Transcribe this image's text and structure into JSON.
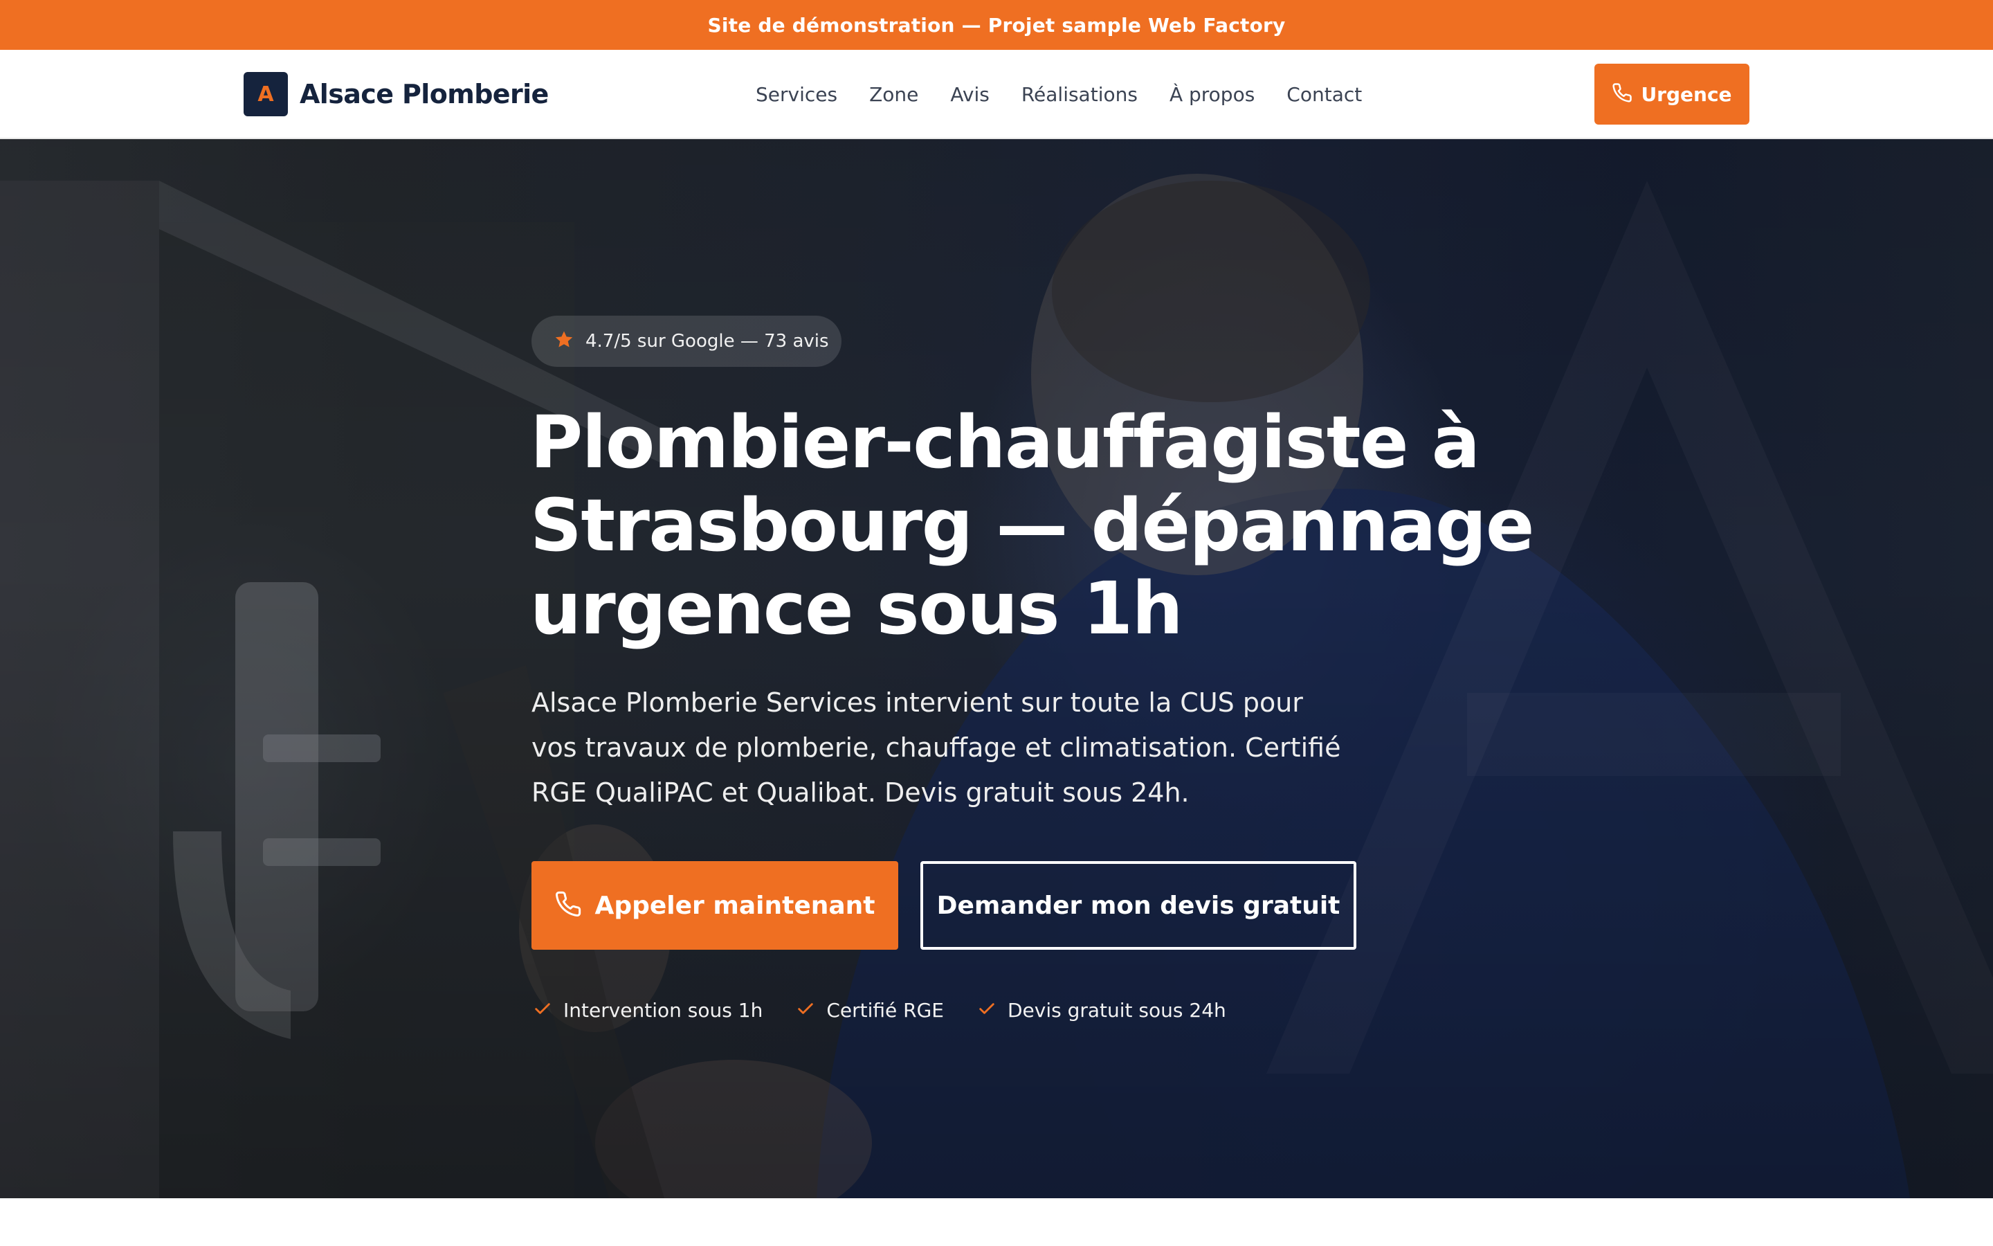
{
  "demo_banner": {
    "text": "Site de démonstration — Projet sample Web Factory"
  },
  "header": {
    "logo_letter": "A",
    "brand_name": "Alsace Plomberie",
    "nav": [
      "Services",
      "Zone",
      "Avis",
      "Réalisations",
      "À propos",
      "Contact"
    ],
    "urgence_label": "Urgence"
  },
  "hero": {
    "rating_text": "4.7/5 sur Google — 73 avis",
    "title_lines": [
      "Plombier-chauffagiste à",
      "Strasbourg — dépannage",
      "urgence sous 1h"
    ],
    "lead_lines": [
      "Alsace Plomberie Services intervient sur toute la CUS pour",
      "vos travaux de plomberie, chauffage et climatisation. Certifié",
      "RGE QualiPAC et Qualibat. Devis gratuit sous 24h."
    ],
    "cta_primary": "Appeler maintenant",
    "cta_secondary": "Demander mon devis gratuit",
    "perks": [
      "Intervention sous 1h",
      "Certifié RGE",
      "Devis gratuit sous 24h"
    ]
  },
  "icons": {
    "phone": "phone-icon",
    "star": "star-icon",
    "check": "check-icon"
  },
  "colors": {
    "accent": "#ef6f22",
    "navy": "#15233d",
    "nav_text": "#3b4353",
    "white": "#ffffff"
  }
}
